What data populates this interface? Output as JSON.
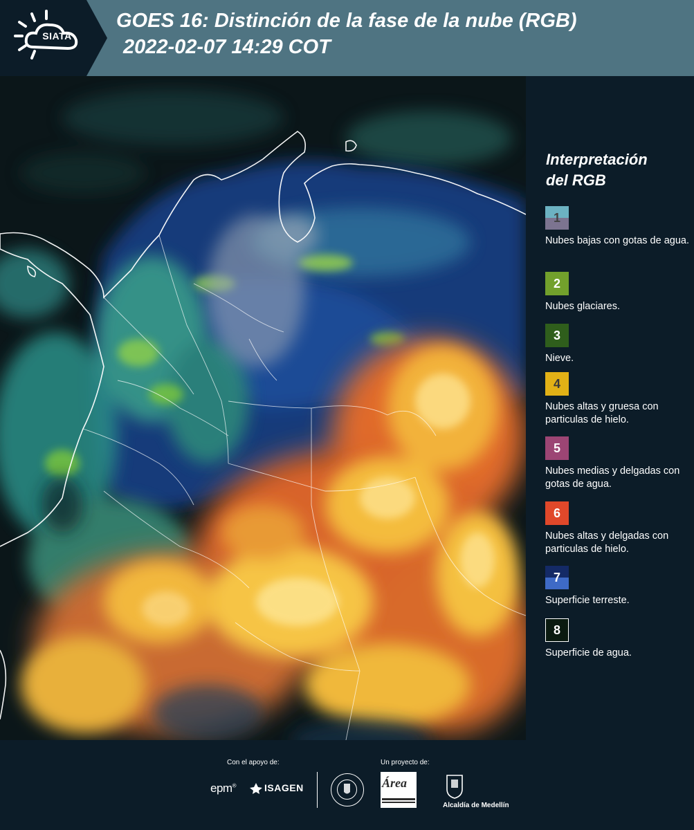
{
  "header": {
    "logo_text": "SIATA",
    "title_line1": "GOES 16: Distinción de la fase de la nube (RGB)",
    "title_line2": "2022-02-07 14:29 COT"
  },
  "legend": {
    "title_line1": "Interpretación",
    "title_line2": "del RGB",
    "items": [
      {
        "number": "1",
        "label": "Nubes bajas con gotas de agua.",
        "color_top": "#6cb2c2",
        "color_bottom": "#7c7490",
        "text_color": "#444444"
      },
      {
        "number": "2",
        "label": "Nubes glaciares.",
        "color_top": "#72a02c",
        "color_bottom": "#72a02c",
        "text_color": "#ffffff"
      },
      {
        "number": "3",
        "label": "Nieve.",
        "color_top": "#2f5e1c",
        "color_bottom": "#2f5e1c",
        "text_color": "#ffffff"
      },
      {
        "number": "4",
        "label": "Nubes altas y gruesa con particulas de hielo.",
        "color_top": "#e2b116",
        "color_bottom": "#e2b116",
        "text_color": "#3a3a3a"
      },
      {
        "number": "5",
        "label": "Nubes medias y delgadas con gotas de agua.",
        "color_top": "#9c4574",
        "color_bottom": "#9c4574",
        "text_color": "#ffffff"
      },
      {
        "number": "6",
        "label": "Nubes altas y delgadas con particulas de hielo.",
        "color_top": "#e0482a",
        "color_bottom": "#e0482a",
        "text_color": "#ffffff"
      },
      {
        "number": "7",
        "label": "Superficie terreste.",
        "color_top": "#142a66",
        "color_bottom": "#3e6ac6",
        "text_color": "#ffffff"
      },
      {
        "number": "8",
        "label": "Superficie de agua.",
        "color_top": "#0a1a10",
        "color_bottom": "#0a1a10",
        "text_color": "#ffffff"
      }
    ]
  },
  "footer": {
    "support_label": "Con el apoyo de:",
    "project_label": "Un proyecto de:",
    "epm": "epm",
    "isagen": "ISAGEN",
    "area": "Área",
    "alcaldia": "Alcaldía de Medellín"
  },
  "colors": {
    "header_bg": "#4f7482",
    "logo_bg": "#0c1c28",
    "page_bg": "#0c1c28"
  }
}
